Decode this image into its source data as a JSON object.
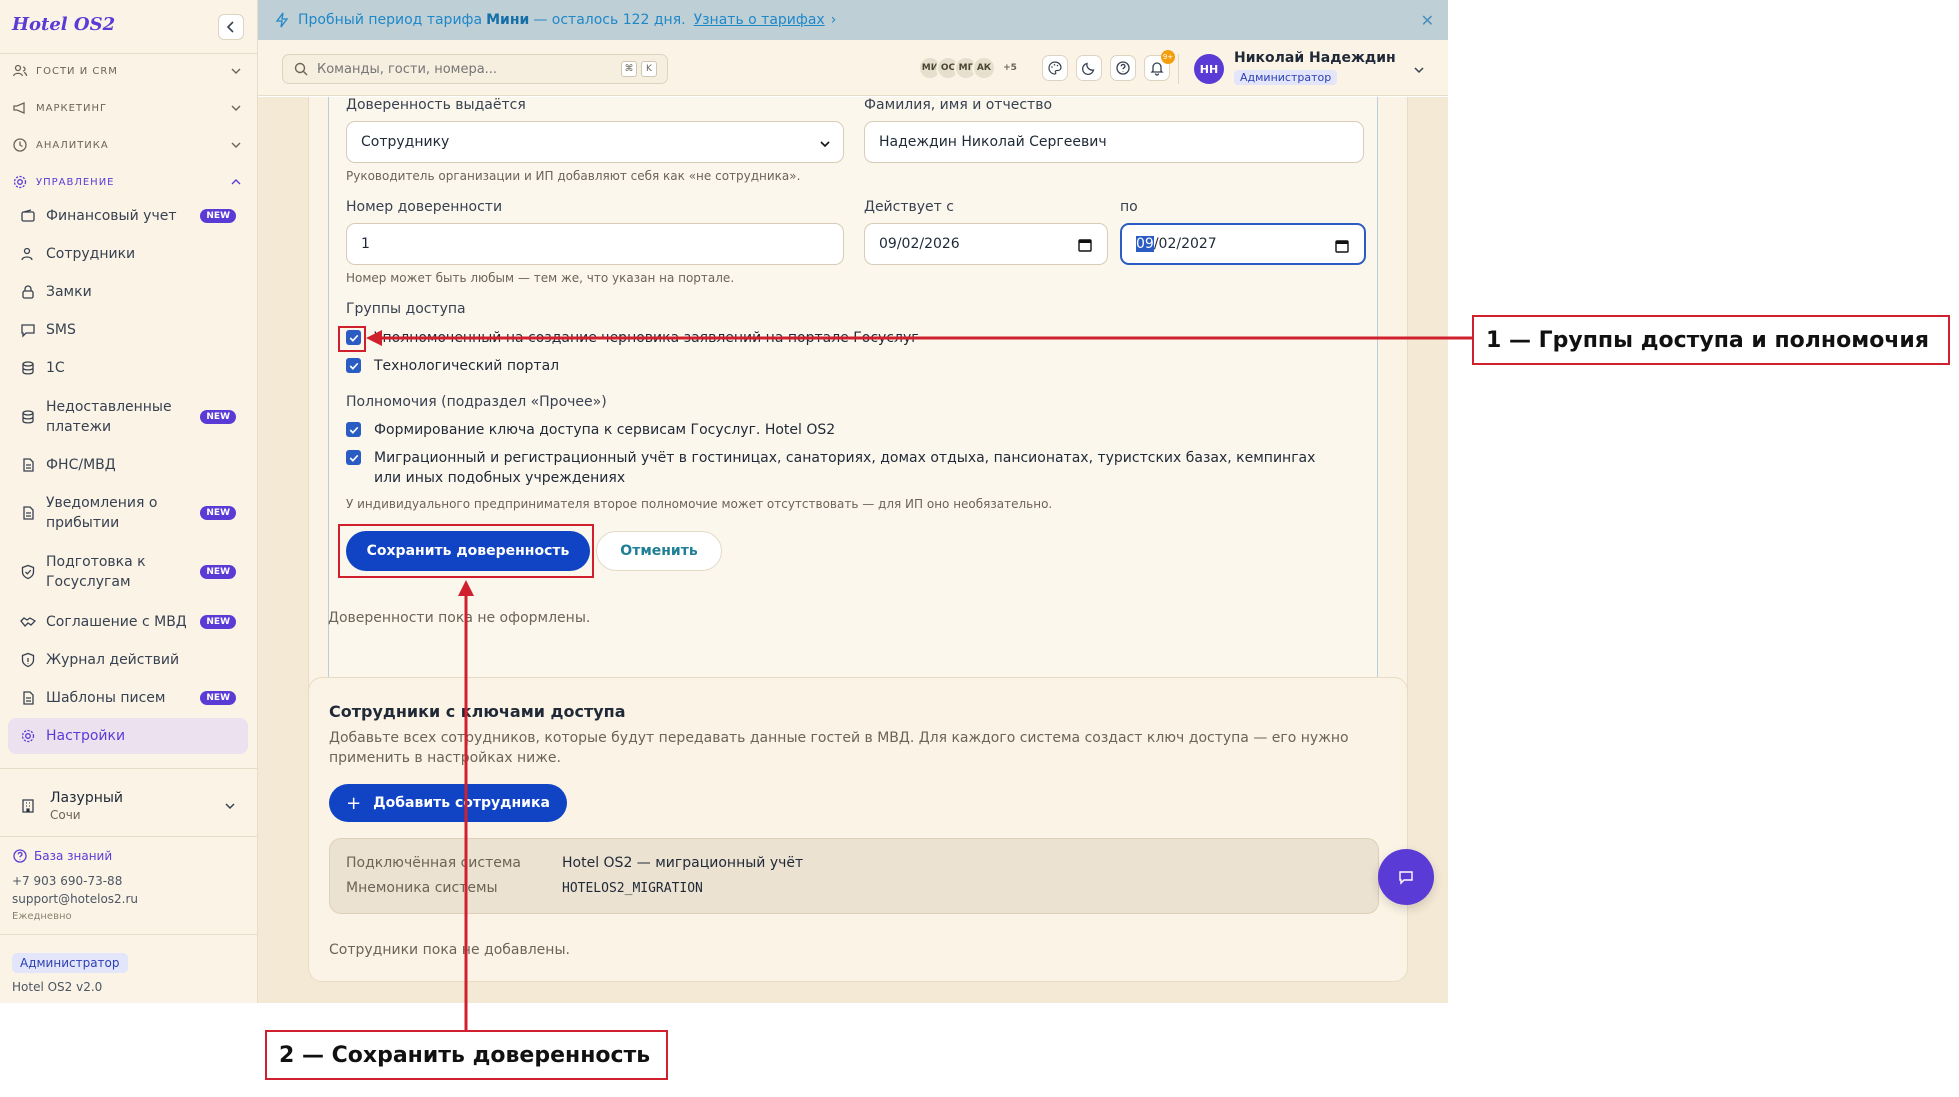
{
  "sidebar": {
    "brand": "Hotel OS2",
    "sections": [
      {
        "label": "ГОСТИ И CRM"
      },
      {
        "label": "МАРКЕТИНГ"
      },
      {
        "label": "АНАЛИТИКА"
      },
      {
        "label": "УПРАВЛЕНИЕ"
      }
    ],
    "items": [
      {
        "label": "Финансовый учет",
        "badge": "NEW"
      },
      {
        "label": "Сотрудники"
      },
      {
        "label": "Замки"
      },
      {
        "label": "SMS"
      },
      {
        "label": "1С"
      },
      {
        "label": "Недоставленные платежи",
        "badge": "NEW"
      },
      {
        "label": "ФНС/МВД"
      },
      {
        "label": "Уведомления о прибытии",
        "badge": "NEW"
      },
      {
        "label": "Подготовка к Госуслугам",
        "badge": "NEW"
      },
      {
        "label": "Соглашение с МВД",
        "badge": "NEW"
      },
      {
        "label": "Журнал действий"
      },
      {
        "label": "Шаблоны писем",
        "badge": "NEW"
      },
      {
        "label": "Настройки"
      }
    ],
    "hotel": {
      "name": "Лазурный",
      "city": "Сочи"
    },
    "knowledge_base": "База знаний",
    "phone": "+7 903 690-73-88",
    "email": "support@hotelos2.ru",
    "hours": "Ежедневно",
    "role": "Администратор",
    "version": "Hotel OS2 v2.0"
  },
  "trial": {
    "text_before": "Пробный период тарифа",
    "plan": "Мини",
    "text_after": "— осталось 122 дня.",
    "link": "Узнать о тарифах"
  },
  "header": {
    "search_placeholder": "Команды, гости, номера...",
    "kbd1": "⌘",
    "kbd2": "K",
    "avatars": [
      "МИ",
      "ОС",
      "МГ",
      "АК"
    ],
    "more": "+5",
    "notif_count": "9+",
    "user_initials": "НН",
    "user_name": "Николай Надеждин",
    "user_role": "Администратор"
  },
  "form": {
    "issued_to_label": "Доверенность выдаётся",
    "issued_to_value": "Сотруднику",
    "issued_to_hint": "Руководитель организации и ИП добавляют себя как «не сотрудника».",
    "fio_label": "Фамилия, имя и отчество",
    "fio_value": "Надеждин Николай Сергеевич",
    "number_label": "Номер доверенности",
    "number_value": "1",
    "number_hint": "Номер может быть любым — тем же, что указан на портале.",
    "valid_from_label": "Действует с",
    "valid_from_value": "09/02/2026",
    "valid_to_label": "по",
    "valid_to_day": "09",
    "valid_to_rest": "/02/2027",
    "groups_label": "Группы доступа",
    "groups": [
      "Уполномоченный на создание черновика заявлений на портале Госуслуг",
      "Технологический портал"
    ],
    "powers_label": "Полномочия (подраздел «Прочее»)",
    "powers": [
      "Формирование ключа доступа к сервисам Госуслуг. Hotel OS2",
      "Миграционный и регистрационный учёт в гостиницах, санаториях, домах отдыха, пансионатах, туристских базах, кемпингах или иных подобных учреждениях"
    ],
    "powers_hint": "У индивидуального предпринимателя второе полномочие может отсутствовать — для ИП оно необязательно.",
    "save": "Сохранить доверенность",
    "cancel": "Отменить",
    "empty": "Доверенности пока не оформлены."
  },
  "employees": {
    "title": "Сотрудники с ключами доступа",
    "desc": "Добавьте всех сотрудников, которые будут передавать данные гостей в МВД. Для каждого система создаст ключ доступа — его нужно применить в настройках ниже.",
    "add": "Добавить сотрудника",
    "system_key": "Подключённая система",
    "system_value": "Hotel OS2 — миграционный учёт",
    "mnemonic_key": "Мнемоника системы",
    "mnemonic_value": "HOTELOS2_MIGRATION",
    "empty": "Сотрудники пока не добавлены."
  },
  "annotations": {
    "a1": "1 — Группы доступа и полномочия",
    "a2": "2 — Сохранить доверенность"
  },
  "colors": {
    "accent": "#5b3bd6",
    "primary": "#1144c5",
    "annotation": "#d0202d"
  }
}
